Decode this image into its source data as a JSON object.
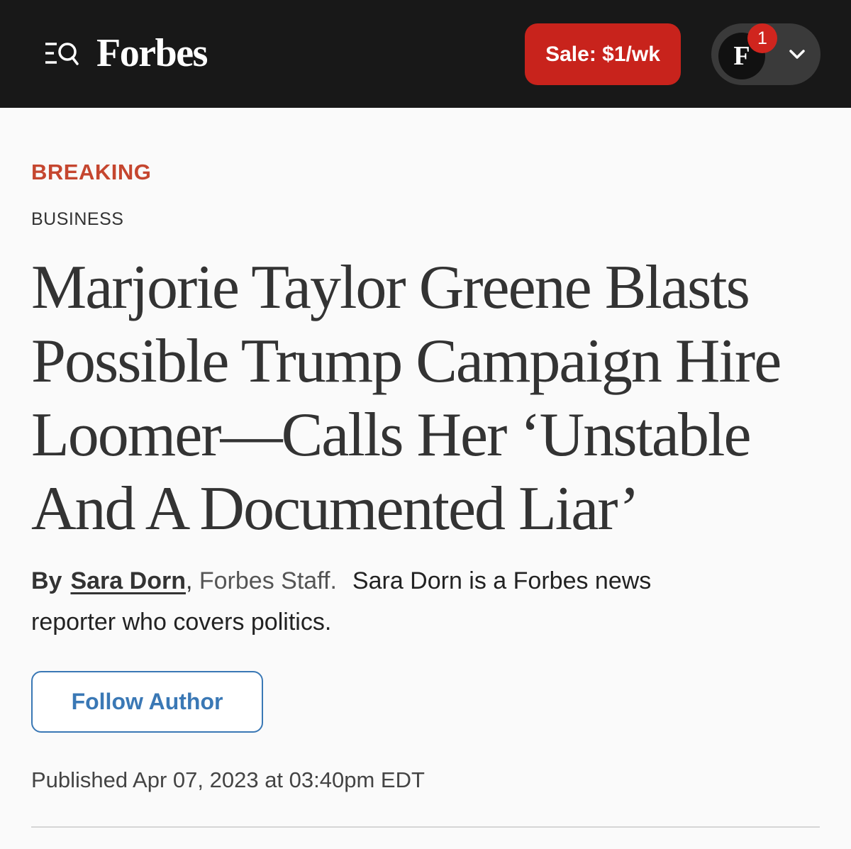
{
  "header": {
    "logo": "Forbes",
    "sale_button": "Sale: $1/wk",
    "avatar_letter": "F",
    "notification_count": "1",
    "background_color": "#181818",
    "sale_color": "#c8231c",
    "badge_color": "#d0251e",
    "icons": [
      "menu-search-icon",
      "chevron-down-icon"
    ]
  },
  "article": {
    "label": "BREAKING",
    "label_color": "#c5462f",
    "section": "BUSINESS",
    "headline": "Marjorie Taylor Greene Blasts Possible Trump Campaign Hire Loomer—Calls Her ‘Unstable And A Documented Liar’",
    "byline": {
      "prefix": "By",
      "author": "Sara Dorn",
      "separator": ",",
      "role": "Forbes Staff.",
      "bio": "Sara Dorn is a Forbes news reporter who covers politics."
    },
    "follow_button": "Follow Author",
    "follow_color": "#3a78b5",
    "published": "Published Apr 07, 2023 at 03:40pm EDT"
  }
}
